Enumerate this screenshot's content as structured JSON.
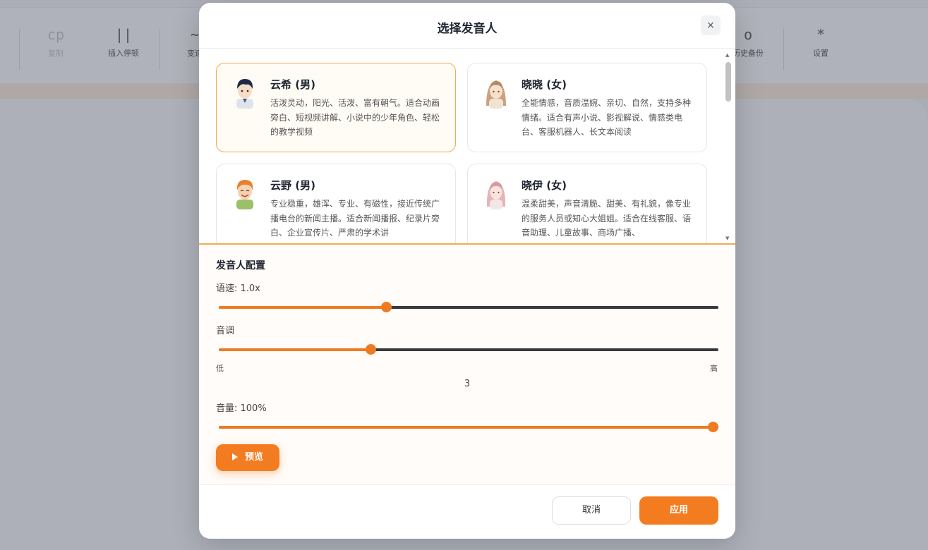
{
  "toolbar": {
    "items": [
      {
        "icon": "cp",
        "label": "复制",
        "icon_name": "copy-icon",
        "disabled": true
      },
      {
        "icon": "||",
        "label": "插入停顿",
        "icon_name": "pause-icon"
      },
      {
        "icon": "~",
        "label": "变速",
        "icon_name": "tilde-icon"
      },
      {
        "icon": "o",
        "label": "历史备份",
        "icon_name": "history-icon"
      },
      {
        "icon": "*",
        "label": "设置",
        "icon_name": "settings-icon"
      }
    ]
  },
  "modal": {
    "title": "选择发音人",
    "close_icon": "×",
    "speakers": [
      {
        "name": "云希 (男)",
        "desc": "活泼灵动，阳光、活泼、富有朝气。适合动画旁白、短视频讲解、小说中的少年角色、轻松的教学视频",
        "selected": true,
        "avatar": "boy-dark-hair-avatar"
      },
      {
        "name": "晓晓 (女)",
        "desc": "全能情感，音质温婉、亲切、自然，支持多种情绪。适合有声小说、影视解说、情感类电台、客服机器人、长文本阅读",
        "selected": false,
        "avatar": "girl-long-hair-avatar"
      },
      {
        "name": "云野 (男)",
        "desc": "专业稳重，雄浑、专业、有磁性，接近传统广播电台的新闻主播。适合新闻播报、纪录片旁白、企业宣传片、严肃的学术讲",
        "selected": false,
        "avatar": "boy-orange-hair-avatar"
      },
      {
        "name": "晓伊 (女)",
        "desc": "温柔甜美，声音清脆、甜美、有礼貌，像专业的服务人员或知心大姐姐。适合在线客服、语音助理、儿童故事、商场广播、",
        "selected": false,
        "avatar": "girl-pink-hair-avatar"
      }
    ],
    "config": {
      "title": "发音人配置",
      "speed_label": "语速: 1.0x",
      "speed_fraction": 0.335,
      "pitch_label": "音调",
      "pitch_fraction": 0.303,
      "pitch_low": "低",
      "pitch_high": "高",
      "pitch_value": "3",
      "volume_label": "音量: 100%",
      "volume_fraction": 1.0,
      "preview_label": "预览"
    },
    "cancel_label": "取消",
    "apply_label": "应用"
  },
  "colors": {
    "accent": "#f47c20",
    "selected_border": "#f3a94e"
  }
}
